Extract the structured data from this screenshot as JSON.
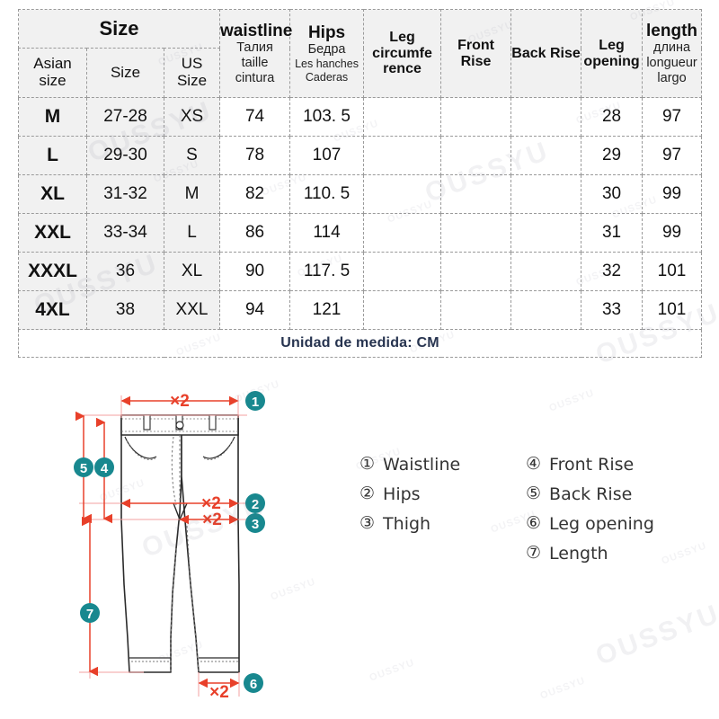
{
  "table": {
    "group_header": "Size",
    "columns": [
      {
        "key": "asian_size",
        "label_en": "Asian",
        "label_en2": "size",
        "type": "sub"
      },
      {
        "key": "size",
        "label_en": "Size",
        "type": "sub"
      },
      {
        "key": "us_size",
        "label_en": "US",
        "label_en2": "Size",
        "type": "sub"
      },
      {
        "key": "waistline",
        "label_en": "waistline",
        "subs": [
          "Талия",
          "taille",
          "cintura"
        ]
      },
      {
        "key": "hips",
        "label_en": "Hips",
        "subs": [
          "Бедра",
          "Les hanches",
          "Caderas"
        ]
      },
      {
        "key": "leg_circumference",
        "label_en": "Leg circumfe rence",
        "subs": []
      },
      {
        "key": "front_rise",
        "label_en": "Front Rise",
        "subs": []
      },
      {
        "key": "back_rise",
        "label_en": "Back Rise",
        "subs": []
      },
      {
        "key": "leg_opening",
        "label_en": "Leg opening",
        "subs": []
      },
      {
        "key": "length",
        "label_en": "length",
        "subs": [
          "длина",
          "longueur",
          "largo"
        ]
      }
    ],
    "rows": [
      {
        "asian_size": "M",
        "size": "27-28",
        "us_size": "XS",
        "waistline": "74",
        "hips": "103. 5",
        "leg_circumference": "",
        "front_rise": "",
        "back_rise": "",
        "leg_opening": "28",
        "length": "97"
      },
      {
        "asian_size": "L",
        "size": "29-30",
        "us_size": "S",
        "waistline": "78",
        "hips": "107",
        "leg_circumference": "",
        "front_rise": "",
        "back_rise": "",
        "leg_opening": "29",
        "length": "97"
      },
      {
        "asian_size": "XL",
        "size": "31-32",
        "us_size": "M",
        "waistline": "82",
        "hips": "110. 5",
        "leg_circumference": "",
        "front_rise": "",
        "back_rise": "",
        "leg_opening": "30",
        "length": "99"
      },
      {
        "asian_size": "XXL",
        "size": "33-34",
        "us_size": "L",
        "waistline": "86",
        "hips": "114",
        "leg_circumference": "",
        "front_rise": "",
        "back_rise": "",
        "leg_opening": "31",
        "length": "99"
      },
      {
        "asian_size": "XXXL",
        "size": "36",
        "us_size": "XL",
        "waistline": "90",
        "hips": "117. 5",
        "leg_circumference": "",
        "front_rise": "",
        "back_rise": "",
        "leg_opening": "32",
        "length": "101"
      },
      {
        "asian_size": "4XL",
        "size": "38",
        "us_size": "XXL",
        "waistline": "94",
        "hips": "121",
        "leg_circumference": "",
        "front_rise": "",
        "back_rise": "",
        "leg_opening": "33",
        "length": "101"
      }
    ],
    "unit_note": "Unidad de medida: CM"
  },
  "legend": {
    "column1": [
      {
        "num": "①",
        "label": "Waistline"
      },
      {
        "num": "②",
        "label": "Hips"
      },
      {
        "num": "③",
        "label": "Thigh"
      }
    ],
    "column2": [
      {
        "num": "④",
        "label": "Front Rise"
      },
      {
        "num": "⑤",
        "label": "Back Rise"
      },
      {
        "num": "⑥",
        "label": "Leg opening"
      },
      {
        "num": "⑦",
        "label": "Length"
      }
    ]
  },
  "diagram": {
    "multiplier_label": "×2",
    "badges": [
      "1",
      "2",
      "3",
      "4",
      "5",
      "6",
      "7"
    ]
  },
  "watermark": {
    "text": "OUSSYU"
  },
  "colors": {
    "badge_teal": "#18888f",
    "arrow_red": "#e8402a",
    "unit_navy": "#26334f",
    "header_bg": "#f1f1f1",
    "border_gray": "#9a9a9a"
  }
}
